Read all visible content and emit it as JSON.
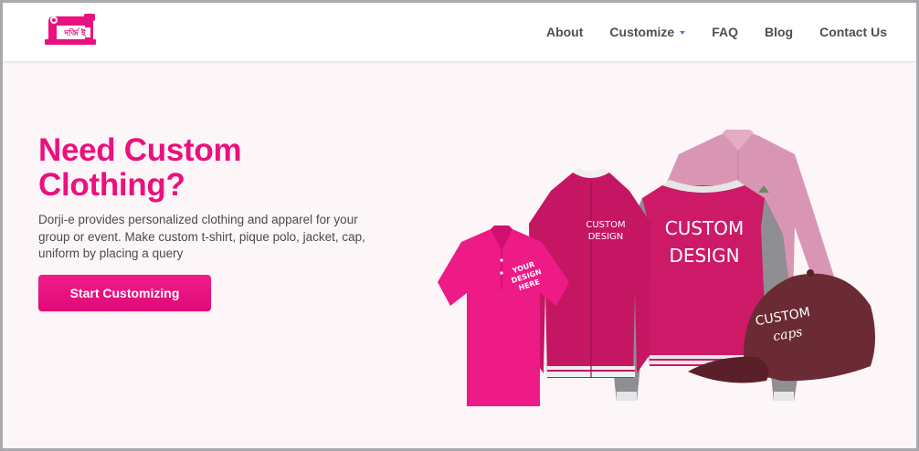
{
  "brand": {
    "logo_text": "দর্জি ই"
  },
  "nav": {
    "items": [
      {
        "label": "About"
      },
      {
        "label": "Customize"
      },
      {
        "label": "FAQ"
      },
      {
        "label": "Blog"
      },
      {
        "label": "Contact Us"
      }
    ]
  },
  "hero": {
    "title": "Need Custom Clothing?",
    "description": "Dorji-e provides personalized clothing and apparel for your group or event. Make custom t-shirt, pique polo, jacket, cap, uniform by placing a query",
    "cta_label": "Start Customizing"
  },
  "products": {
    "jacket_front_text": [
      "CUSTOM",
      "DESIGN"
    ],
    "polo_text": [
      "YOUR",
      "DESIGN",
      "HERE"
    ],
    "jacket_back_text": [
      "CUSTOM",
      "DESIGN"
    ],
    "cap_text": [
      "CUSTOM",
      "caps"
    ]
  },
  "colors": {
    "brand_pink": "#ea117f",
    "nav_text": "#4e4e54",
    "caret": "#4d7fd4",
    "hero_bg": "#fcf6f9"
  }
}
